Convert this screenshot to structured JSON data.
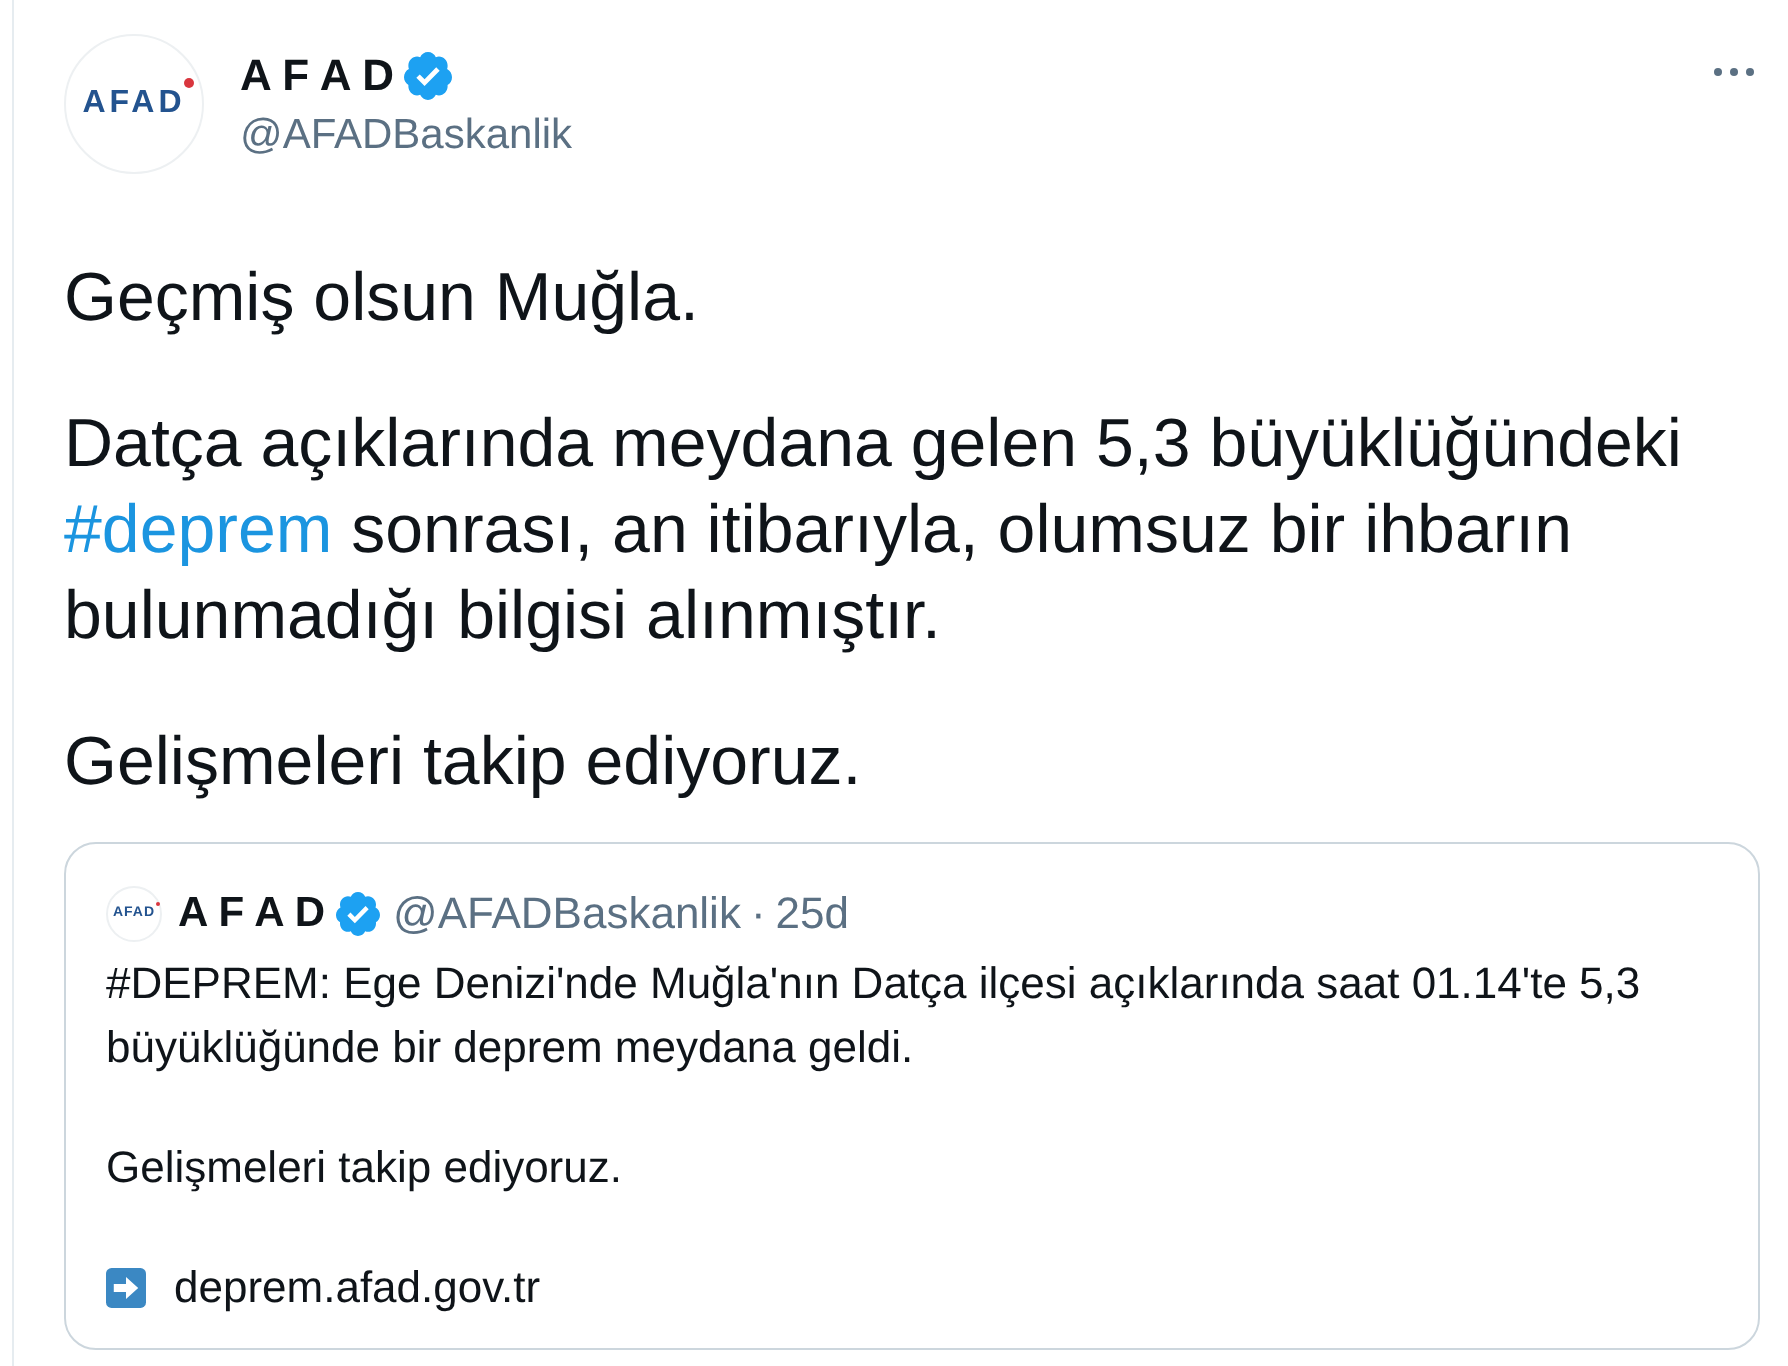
{
  "author": {
    "avatar_logo": "AFAD",
    "name": "A F A D",
    "verified": true,
    "handle": "@AFADBaskanlik"
  },
  "tweet": {
    "paragraphs": [
      {
        "parts": [
          {
            "kind": "text",
            "text": "Geçmiş olsun Muğla."
          }
        ]
      },
      {
        "parts": [
          {
            "kind": "text",
            "text": "Datça açıklarında meydana gelen 5,3 büyüklüğündeki "
          },
          {
            "kind": "hashtag",
            "text": "#deprem"
          },
          {
            "kind": "text",
            "text": " sonrası, an itibarıyla, olumsuz bir ihbarın bulunmadığı bilgisi alınmıştır."
          }
        ]
      },
      {
        "parts": [
          {
            "kind": "text",
            "text": "Gelişmeleri takip ediyoruz."
          }
        ]
      }
    ]
  },
  "quoted_tweet": {
    "avatar_logo": "AFAD",
    "name": "A F A D",
    "verified": true,
    "handle": "@AFADBaskanlik",
    "separator": "·",
    "time": "25d",
    "paragraphs": [
      "#DEPREM: Ege Denizi'nde Muğla'nın Datça ilçesi açıklarında saat 01.14'te 5,3 büyüklüğünde bir deprem meydana geldi.",
      "Gelişmeleri takip ediyoruz."
    ],
    "link": "deprem.afad.gov.tr"
  }
}
